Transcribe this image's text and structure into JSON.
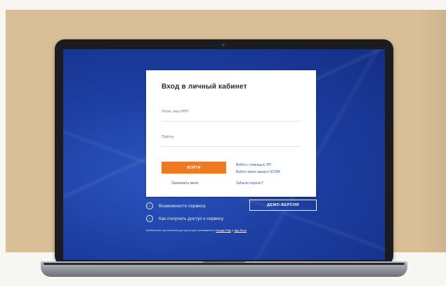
{
  "login": {
    "title": "Вход в личный кабинет",
    "login_label": "Логин, ваш ИНН",
    "password_label": "Пароль",
    "login_button": "ВОЙТИ",
    "link_key": "Войти с помощью ЭП",
    "link_esia": "Войти через аккаунт ЕСИА",
    "remember": "Запомнить меня",
    "forgot": "Забыли пароль?"
  },
  "features": {
    "item1": "Возможности сервиса",
    "item2": "Как получить доступ к сервису",
    "demo_button": "ДЕМО-ВЕРСИЯ"
  },
  "apps": {
    "text": "Мобильные приложения доступны для скачивания в",
    "store1": "Google Play",
    "conj": "и",
    "store2": "App Store"
  },
  "colors": {
    "screen_bg": "#1d3fa3",
    "accent_orange": "#f07a22",
    "link_blue": "#2f5fc7"
  },
  "icons": {
    "feature": "chevron-down-circle-icon"
  }
}
